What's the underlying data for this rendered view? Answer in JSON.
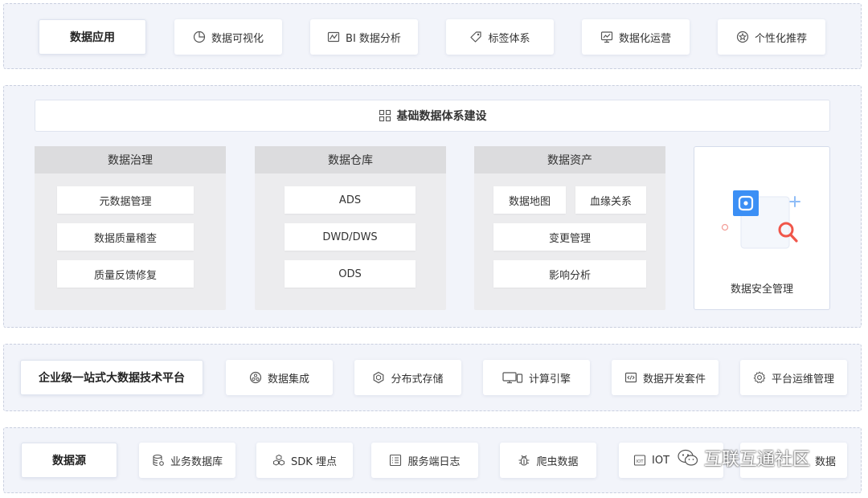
{
  "data_app": {
    "title": "数据应用",
    "items": [
      {
        "icon": "pie-chart-icon",
        "label": "数据可视化"
      },
      {
        "icon": "chart-analysis-icon",
        "label": "BI 数据分析"
      },
      {
        "icon": "tag-icon",
        "label": "标签体系"
      },
      {
        "icon": "monitor-chart-icon",
        "label": "数据化运营"
      },
      {
        "icon": "star-circle-icon",
        "label": "个性化推荐"
      }
    ]
  },
  "foundation": {
    "header": "基础数据体系建设",
    "governance": {
      "title": "数据治理",
      "items": [
        "元数据管理",
        "数据质量稽查",
        "质量反馈修复"
      ]
    },
    "warehouse": {
      "title": "数据仓库",
      "items": [
        "ADS",
        "DWD/DWS",
        "ODS"
      ]
    },
    "assets": {
      "title": "数据资产",
      "items": [
        "数据地图",
        "血缘关系",
        "变更管理",
        "影响分析"
      ]
    },
    "security": {
      "title": "数据安全管理"
    }
  },
  "platform": {
    "title": "企业级一站式大数据技术平台",
    "items": [
      {
        "icon": "integration-icon",
        "label": "数据集成"
      },
      {
        "icon": "hexagon-storage-icon",
        "label": "分布式存储"
      },
      {
        "icon": "compute-engine-icon",
        "label": "计算引擎"
      },
      {
        "icon": "dev-kit-icon",
        "label": "数据开发套件"
      },
      {
        "icon": "gear-icon",
        "label": "平台运维管理"
      }
    ]
  },
  "sources": {
    "title": "数据源",
    "items": [
      {
        "icon": "database-icon",
        "label": "业务数据库"
      },
      {
        "icon": "cubes-icon",
        "label": "SDK 埋点"
      },
      {
        "icon": "log-list-icon",
        "label": "服务端日志"
      },
      {
        "icon": "bug-icon",
        "label": "爬虫数据"
      },
      {
        "icon": "iot-icon",
        "label": "IOT"
      },
      {
        "icon": "",
        "label": "数据"
      }
    ]
  },
  "watermark": "互联互通社区",
  "colors": {
    "accent": "#3b8ff5",
    "band_bg": "#f2f4fa",
    "column_bg": "#ececee",
    "column_head": "#dcdcde",
    "magnifier": "#f0564a"
  }
}
